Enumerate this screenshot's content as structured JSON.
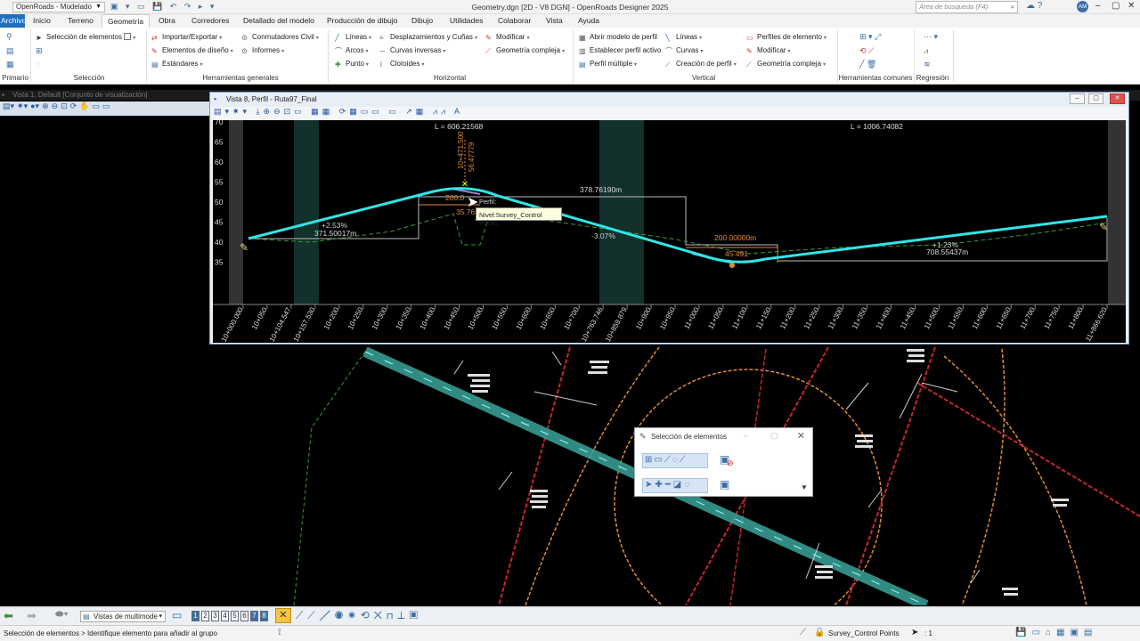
{
  "app": {
    "workspace": "OpenRoads - Modelado",
    "title": "Geometry.dgn [2D - V8 DGN] - OpenRoads Designer 2025",
    "search_placeholder": "Área de búsqueda (F4)",
    "user_initials": "AM"
  },
  "menu": {
    "file": "Archivo",
    "tabs": [
      "Inicio",
      "Terreno",
      "Geometría",
      "Obra",
      "Corredores",
      "Detallado del modelo",
      "Producción de dibujo",
      "Dibujo",
      "Utilidades",
      "Colaborar",
      "Vista",
      "Ayuda"
    ],
    "active_tab": "Geometría"
  },
  "ribbon": {
    "seleccion": {
      "item": "Selección de elementos",
      "group": "Selección"
    },
    "primario": {
      "group": "Primario"
    },
    "herramientas_generales": {
      "col1": [
        "Importar/Exportar",
        "Elementos de diseño",
        "Estándares"
      ],
      "col2": [
        "Conmutadores Civil",
        "Informes"
      ],
      "group": "Herramientas generales"
    },
    "horizontal": {
      "col1": [
        "Líneas",
        "Arcos",
        "Punto"
      ],
      "col2": [
        "Desplazamientos y Cuñas",
        "Curvas inversas",
        "Clotoides"
      ],
      "col3": [
        "Modificar",
        "Geometría compleja"
      ],
      "group": "Horizontal"
    },
    "vertical": {
      "col1": [
        "Abrir modelo de perfil",
        "Establecer perfil activo",
        "Perfil múltiple"
      ],
      "col2": [
        "Líneas",
        "Curvas",
        "Creación de perfil"
      ],
      "col3": [
        "Perfiles de elemento",
        "Modificar",
        "Geometría compleja"
      ],
      "group": "Vertical"
    },
    "herramientas_comunes": {
      "group": "Herramientas comunes"
    },
    "regresion": {
      "group": "Regresión"
    }
  },
  "view1": {
    "title": "Vista 1, Default [Conjunto de visualización]"
  },
  "view8": {
    "title": "Vista 8, Perfil - Ruta97_Final",
    "y_ticks": [
      "70",
      "65",
      "60",
      "55",
      "50",
      "45",
      "40",
      "35"
    ],
    "x_ticks": [
      "10+000.000",
      "10+050",
      "10+104.547",
      "10+157.530",
      "10+200",
      "10+250",
      "10+300",
      "10+350",
      "10+400",
      "10+450",
      "10+500",
      "10+550",
      "10+600",
      "10+650",
      "10+700",
      "10+763.746",
      "10+859.879",
      "10+900",
      "10+950",
      "11+000",
      "11+050",
      "11+100",
      "11+150",
      "11+200",
      "11+250",
      "11+300",
      "11+350",
      "11+400",
      "11+450",
      "11+500",
      "11+550",
      "11+600",
      "11+650",
      "11+700",
      "11+750",
      "11+800",
      "11+866.620"
    ],
    "labels": {
      "L1": "L = 606.21568",
      "L2": "L = 1006.74082",
      "station_vertical": "10+471.500",
      "elev_vertical": "56.47779",
      "grade1": "+2.53%",
      "len1": "371.50017m",
      "vc1": "200.0",
      "vc1_elev": "35.76",
      "len2": "378.76190m",
      "grade2": "-3.07%",
      "vc2": "200.00000m",
      "vc2_elev": "45.491",
      "grade3": "+1.23%",
      "len3": "708.55437m"
    },
    "tooltip": {
      "line1": "Perfil:",
      "line2": "Nivel:Survey_Control Points"
    }
  },
  "selection_dialog": {
    "title": "Selección de elementos"
  },
  "bottom": {
    "views_dropdown": "Vistas de multimode",
    "view_numbers": [
      "1",
      "2",
      "3",
      "4",
      "5",
      "6",
      "7",
      "8"
    ]
  },
  "status": {
    "message": "Selección de elementos > Identifique elemento para añadir al grupo",
    "level": "Survey_Control Points",
    "count": ": 1"
  },
  "colors": {
    "accent": "#1f6fbf",
    "profile": "#2fe6e6",
    "grid": "#1f4a48",
    "alignment_teal": "#3aa39a",
    "red_line": "#c4262e",
    "orange_line": "#e28a3a"
  }
}
